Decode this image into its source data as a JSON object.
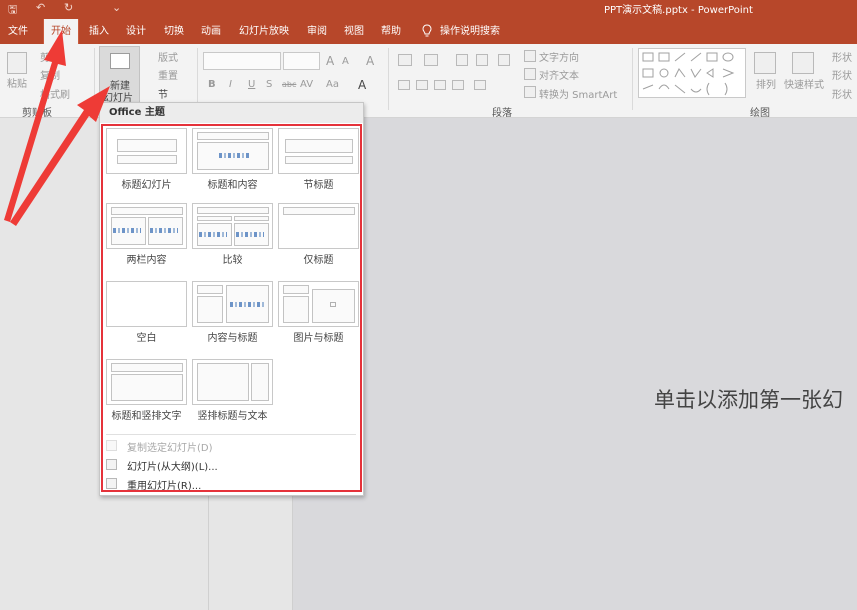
{
  "titlebar": {
    "title": "PPT演示文稿.pptx  -  PowerPoint",
    "qa_save": "🖫",
    "qa_undo": "↶",
    "qa_redo": "↻",
    "qa_more": "⌄"
  },
  "tabs": [
    {
      "label": "文件"
    },
    {
      "label": "开始"
    },
    {
      "label": "插入"
    },
    {
      "label": "设计"
    },
    {
      "label": "切换"
    },
    {
      "label": "动画"
    },
    {
      "label": "幻灯片放映"
    },
    {
      "label": "审阅"
    },
    {
      "label": "视图"
    },
    {
      "label": "帮助"
    },
    {
      "label": "操作说明搜索"
    }
  ],
  "ribbon": {
    "clipboard": {
      "paste": "粘贴",
      "cut": "剪切",
      "copy": "复制",
      "format_painter": "格式刷",
      "group_label": "剪贴板"
    },
    "slides": {
      "new_slide_line1": "新建",
      "new_slide_line2": "幻灯片",
      "layout": "版式",
      "reset": "重置",
      "section": "节"
    },
    "font": {
      "bold": "B",
      "italic": "I",
      "underline": "U",
      "shadow": "S",
      "strike": "abc",
      "spacing": "AV",
      "case": "Aa",
      "color": "A"
    },
    "paragraph": {
      "text_direction": "文字方向",
      "align_text": "对齐文本",
      "smartart": "转换为 SmartArt",
      "group_label": "段落"
    },
    "drawing": {
      "arrange": "排列",
      "quick_styles": "快速样式",
      "fill": "形状",
      "outline": "形状",
      "effects": "形状",
      "group_label": "绘图"
    }
  },
  "dropdown": {
    "header": "Office 主题",
    "layouts": [
      {
        "name": "标题幻灯片"
      },
      {
        "name": "标题和内容"
      },
      {
        "name": "节标题"
      },
      {
        "name": "两栏内容"
      },
      {
        "name": "比较"
      },
      {
        "name": "仅标题"
      },
      {
        "name": "空白"
      },
      {
        "name": "内容与标题"
      },
      {
        "name": "图片与标题"
      },
      {
        "name": "标题和竖排文字"
      },
      {
        "name": "竖排标题与文本"
      }
    ],
    "menu": [
      {
        "label": "复制选定幻灯片(D)",
        "disabled": true
      },
      {
        "label": "幻灯片(从大纲)(L)...",
        "disabled": false
      },
      {
        "label": "重用幻灯片(R)...",
        "disabled": false
      }
    ]
  },
  "slide": {
    "placeholder": "单击以添加第一张幻"
  },
  "colors": {
    "accent": "#b7472a",
    "highlight": "#e5323a"
  }
}
